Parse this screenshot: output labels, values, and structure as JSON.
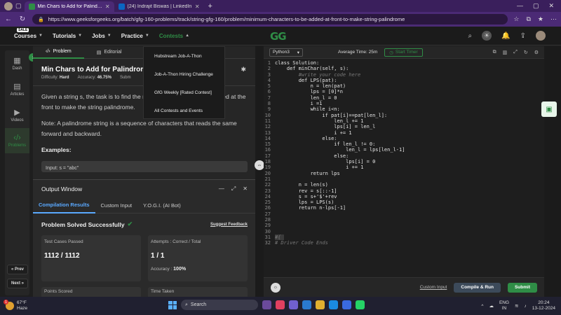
{
  "browser": {
    "tabs": [
      {
        "label": "Min Chars to Add for Palindrome",
        "active": true
      },
      {
        "label": "(24) Indrajit Biswas | LinkedIn",
        "active": false
      }
    ],
    "url": "https://www.geeksforgeeks.org/batch/gfg-160-problems/track/string-gfg-160/problem/minimum-characters-to-be-added-at-front-to-make-string-palindrome"
  },
  "header": {
    "nav": [
      {
        "label": "Courses",
        "badge": "SALE"
      },
      {
        "label": "Tutorials"
      },
      {
        "label": "Jobs"
      },
      {
        "label": "Practice"
      },
      {
        "label": "Contests"
      }
    ],
    "logo": "GG"
  },
  "contests_menu": [
    "Hubstream Job-A-Thon",
    "Job-A-Thon Hiring Challenge",
    "GfG Weekly [Rated Contest]",
    "All Contests and Events"
  ],
  "sidebar": {
    "items": [
      {
        "label": "Dash"
      },
      {
        "label": "Articles"
      },
      {
        "label": "Videos"
      },
      {
        "label": "Problems"
      }
    ],
    "prev": "« Prev",
    "next": "Next »"
  },
  "problem": {
    "tabs": {
      "problem": "Problem",
      "editorial": "Editorial"
    },
    "title": "Min Chars to Add for Palindrome",
    "difficulty_label": "Difficulty:",
    "difficulty": "Hard",
    "accuracy_label": "Accuracy:",
    "accuracy": "46.75%",
    "submissions_label": "Subm",
    "para1": "Given a string s, the task is to find the minimum characters to be added at the front to make the string palindrome.",
    "para2": "Note: A palindrome string is a sequence of characters that reads the same forward and backward.",
    "examples": "Examples:",
    "input": "Input:  s = \"abc\""
  },
  "output": {
    "title": "Output Window",
    "tabs": [
      "Compilation Results",
      "Custom Input",
      "Y.O.G.I. (AI Bot)"
    ],
    "status": "Problem Solved Successfully",
    "feedback": "Suggest Feedback",
    "tests_label": "Test Cases Passed",
    "tests_value": "1112 / 1112",
    "attempts_label": "Attempts : Correct / Total",
    "attempts_value": "1 / 1",
    "accuracy_label": "Accuracy :",
    "accuracy_value": "100%",
    "points_label": "Points Scored",
    "time_label": "Time Taken"
  },
  "editor": {
    "language": "Python3",
    "avg_time": "Average Time: 25m",
    "timer": "Start Timer",
    "lines": [
      "class Solution:",
      "    def minChar(self, s):",
      "        #write your code here",
      "        def LPS(pat):",
      "            n = len(pat)",
      "            lps = [0]*n",
      "            len_l = 0",
      "            i =1",
      "            while i<n:",
      "                if pat[i]==pat[len_l]:",
      "                    len_l += 1",
      "                    lps[i] = len_l",
      "                    i += 1",
      "                else:",
      "                    if len_l != 0:",
      "                        len_l = lps[len_l-1]",
      "                    else:",
      "                        lps[i] = 0",
      "                        i += 1",
      "            return lps",
      "",
      "        n = len(s)",
      "        rev = s[::-1]",
      "        s = s+'$'+rev",
      "        lps = LPS(s)",
      "        return n-lps[-1]",
      "",
      "",
      "",
      "",
      "#{ ",
      "# Driver Code Ends"
    ],
    "custom_input": "Custom Input",
    "compile": "Compile & Run",
    "submit": "Submit"
  },
  "taskbar": {
    "temp": "67°F",
    "weather": "Haze",
    "search": "Search",
    "lang1": "ENG",
    "lang2": "IN",
    "time": "20:24",
    "date": "13-12-2024",
    "notif": "1"
  }
}
